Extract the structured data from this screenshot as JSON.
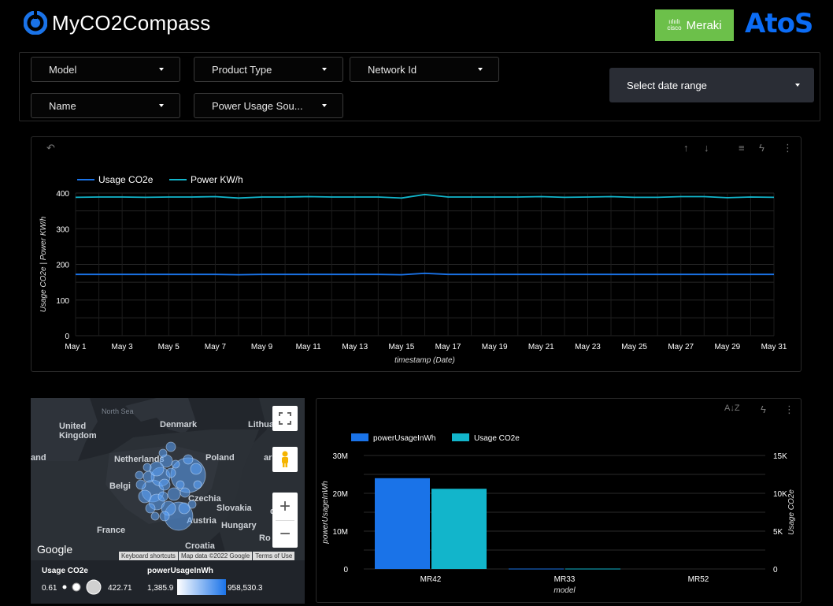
{
  "header": {
    "app_title": "MyCO2Compass",
    "partner_logo_text": "Meraki",
    "partner_logo_small_top": "ıılıılı",
    "partner_logo_small_bottom": "cisco",
    "brand_logo_text": "AtoS"
  },
  "filters": {
    "model": "Model",
    "product_type": "Product Type",
    "network_id": "Network Id",
    "name": "Name",
    "power_usage_source": "Power Usage Sou...",
    "date_range": "Select date range"
  },
  "line_chart": {
    "toolbar_icons": [
      "undo-icon",
      "sort-asc-icon",
      "sort-desc-icon",
      "filter-icon",
      "bolt-icon",
      "more-icon"
    ]
  },
  "map": {
    "countries": [
      "United Kingdom",
      "Denmark",
      "Lithua",
      "Netherlands",
      "Poland",
      "Belgi",
      "Czechia",
      "Slovakia",
      "France",
      "Austria",
      "Hungary",
      "Croatia",
      "Ro",
      "d",
      "ar",
      "and"
    ],
    "sea_label": "North Sea",
    "google_label": "Google",
    "attribution": [
      "Keyboard shortcuts",
      "Map data ©2022 Google",
      "Terms of Use"
    ],
    "legend": {
      "size_title": "Usage CO2e",
      "size_min": "0.61",
      "size_max": "422.71",
      "color_title": "powerUsageInWh",
      "color_min": "1,385.9",
      "color_max": "958,530.3"
    }
  },
  "bar_chart": {
    "toolbar_icons": [
      "sort-az-icon",
      "bolt-icon",
      "more-icon"
    ]
  },
  "colors": {
    "series_blue": "#1a73e8",
    "series_teal": "#12b5cb",
    "background": "#000000",
    "meraki_green": "#6cc04a",
    "atos_blue": "#0b6cf5"
  },
  "chart_data": [
    {
      "type": "line",
      "title": "",
      "xlabel": "timestamp (Date)",
      "ylabel": "Usage CO2e | Power KW/h",
      "ylim": [
        0,
        400
      ],
      "y_ticks": [
        "0",
        "100",
        "200",
        "300",
        "400"
      ],
      "x": [
        "May 1",
        "May 2",
        "May 3",
        "May 4",
        "May 5",
        "May 6",
        "May 7",
        "May 8",
        "May 9",
        "May 10",
        "May 11",
        "May 12",
        "May 13",
        "May 14",
        "May 15",
        "May 16",
        "May 17",
        "May 18",
        "May 19",
        "May 20",
        "May 21",
        "May 22",
        "May 23",
        "May 24",
        "May 25",
        "May 26",
        "May 27",
        "May 28",
        "May 29",
        "May 30",
        "May 31"
      ],
      "x_tick_labels": [
        "May 1",
        "May 3",
        "May 5",
        "May 7",
        "May 9",
        "May 11",
        "May 13",
        "May 15",
        "May 17",
        "May 19",
        "May 21",
        "May 23",
        "May 25",
        "May 27",
        "May 29",
        "May 31"
      ],
      "legend": "top-left",
      "grid": true,
      "series": [
        {
          "name": "Usage CO2e",
          "color": "#1a73e8",
          "values": [
            172,
            172,
            172,
            172,
            172,
            172,
            172,
            171,
            172,
            172,
            172,
            172,
            172,
            172,
            171,
            175,
            172,
            172,
            172,
            172,
            172,
            172,
            172,
            172,
            172,
            172,
            172,
            172,
            172,
            172,
            172
          ]
        },
        {
          "name": "Power KW/h",
          "color": "#12b5cb",
          "values": [
            388,
            389,
            389,
            388,
            389,
            389,
            390,
            386,
            389,
            389,
            390,
            389,
            389,
            389,
            386,
            396,
            389,
            389,
            389,
            389,
            390,
            388,
            389,
            390,
            388,
            388,
            390,
            390,
            387,
            389,
            388
          ]
        }
      ]
    },
    {
      "type": "bar",
      "title": "",
      "xlabel": "model",
      "ylabel": "powerUsageInWh",
      "ylabel_right": "Usage CO2e",
      "categories": [
        "MR42",
        "MR33",
        "MR52"
      ],
      "ylim": [
        0,
        30000000
      ],
      "ylim_right": [
        0,
        15000
      ],
      "y_ticks": [
        "0",
        "10M",
        "20M",
        "30M"
      ],
      "y_ticks_right": [
        "0",
        "5K",
        "10K",
        "15K"
      ],
      "legend": "top-left",
      "grid": true,
      "series": [
        {
          "name": "powerUsageInWh",
          "color": "#1a73e8",
          "axis": "left",
          "values": [
            24000000,
            100000,
            0
          ]
        },
        {
          "name": "Usage CO2e",
          "color": "#12b5cb",
          "axis": "right",
          "values": [
            10600,
            50,
            0
          ]
        }
      ]
    }
  ]
}
